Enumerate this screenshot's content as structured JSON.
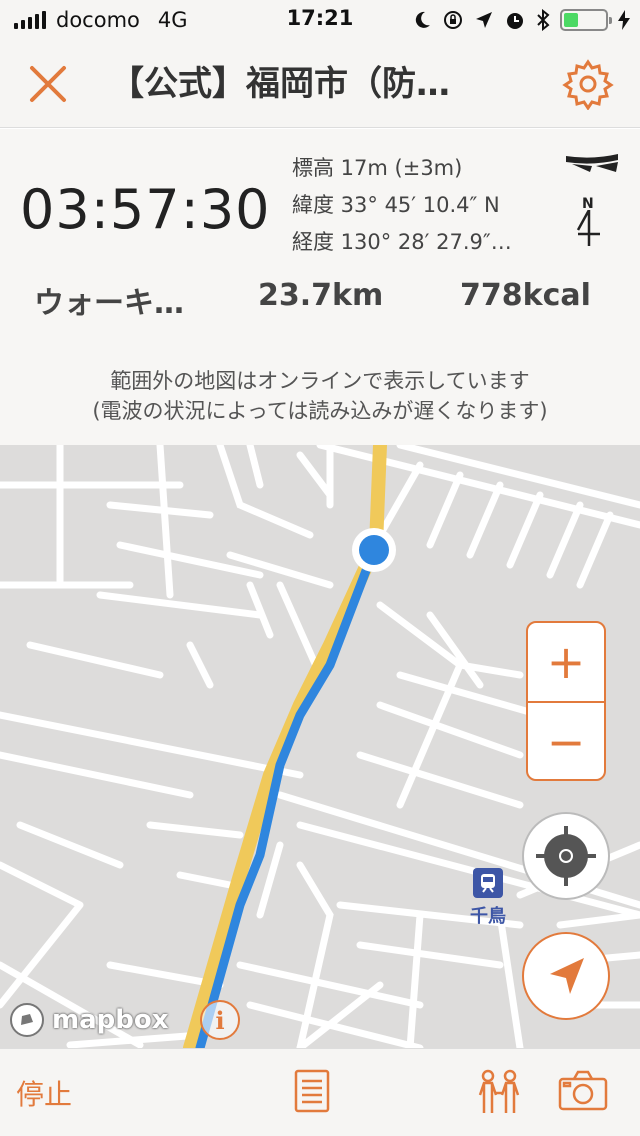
{
  "status_bar": {
    "carrier": "docomo",
    "network": "4G",
    "time": "17:21",
    "battery_level": 0.35,
    "icons": [
      "moon-icon",
      "rotation-lock-icon",
      "location-arrow-icon",
      "alarm-icon",
      "bluetooth-icon",
      "battery-icon",
      "charging-icon"
    ]
  },
  "navbar": {
    "title": "【公式】福岡市（防…",
    "close_icon": "close-icon",
    "settings_icon": "gear-icon"
  },
  "info": {
    "elapsed": "03:57:30",
    "elevation": "標高 17m (±3m)",
    "latitude": "緯度 33° 45′ 10.4″ N",
    "longitude": "経度 130° 28′ 27.9″…",
    "compass_label": "N",
    "activity": "ウォーキ…",
    "distance": "23.7km",
    "calories": "778kcal"
  },
  "notice": {
    "line1": "範囲外の地図はオンラインで表示しています",
    "line2": "(電波の状況によっては読み込みが遅くなります)"
  },
  "map": {
    "station_label": "千鳥",
    "attribution": "mapbox",
    "zoom_in": "+",
    "zoom_out": "−",
    "info_label": "i",
    "colors": {
      "accent": "#e27a3c",
      "track": "#2f86de",
      "planned_route": "#f0c95a",
      "station": "#3d56a6"
    }
  },
  "toolbar": {
    "stop_label": "停止",
    "icons": [
      "list-icon",
      "people-icon",
      "camera-icon"
    ]
  }
}
